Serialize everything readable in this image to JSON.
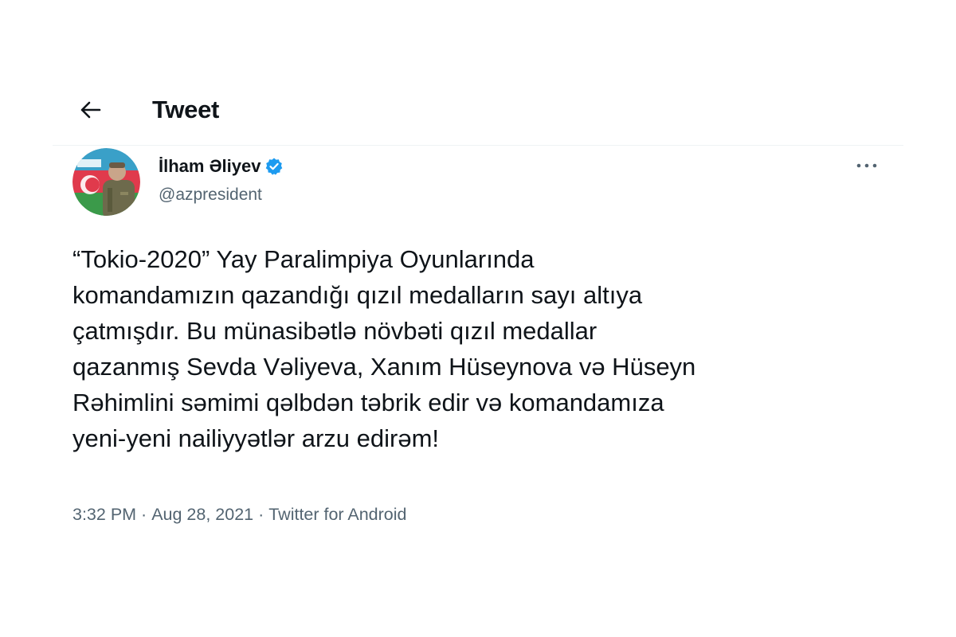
{
  "header": {
    "back_icon": "arrow-left-icon",
    "title": "Tweet"
  },
  "tweet": {
    "author": {
      "name": "İlham Əliyev",
      "handle": "@azpresident",
      "verified_icon": "verified-badge-icon"
    },
    "more_icon": "more-horizontal-icon",
    "text": "“Tokio-2020” Yay Paralimpiya Oyunlarında\nkomandamızın qazandığı qızıl medalların sayı altıya\nçatmışdır. Bu münasibətlə növbəti qızıl medallar\nqazanmış Sevda Vəliyeva, Xanım Hüseynova və Hüseyn\nRəhimlini səmimi qəlbdən təbrik edir və komandamıza\nyeni-yeni nailiyyətlər arzu edirəm!",
    "time": "3:32 PM",
    "date": "Aug 28, 2021",
    "source": "Twitter for Android",
    "separator": " · "
  },
  "colors": {
    "text_primary": "#0f1419",
    "text_secondary": "#536471",
    "verified_blue": "#1d9bf0",
    "divider": "#eff3f4"
  }
}
